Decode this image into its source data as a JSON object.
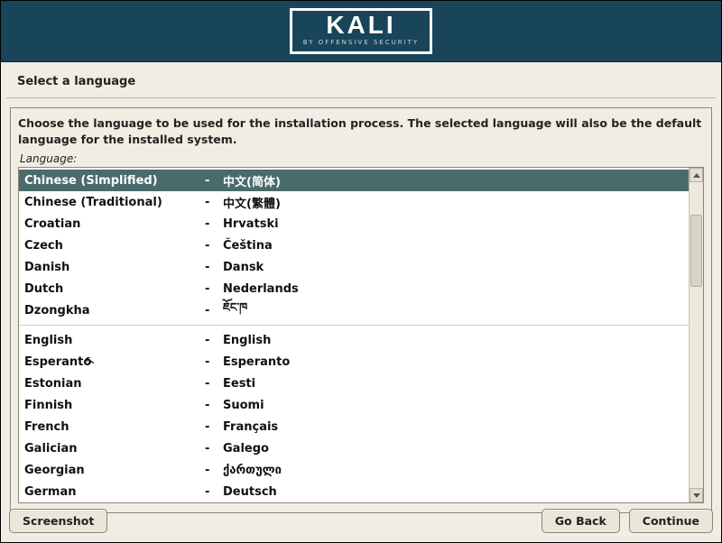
{
  "logo": {
    "text": "KALI",
    "subtitle": "BY OFFENSIVE SECURITY"
  },
  "title": "Select a language",
  "instruction": "Choose the language to be used for the installation process. The selected language will also be the default language for the installed system.",
  "field_label": "Language:",
  "selected_index": 0,
  "languages": [
    {
      "name": "Chinese (Simplified)",
      "native": "中文(简体)",
      "group": 1
    },
    {
      "name": "Chinese (Traditional)",
      "native": "中文(繁體)",
      "group": 1
    },
    {
      "name": "Croatian",
      "native": "Hrvatski",
      "group": 1
    },
    {
      "name": "Czech",
      "native": "Čeština",
      "group": 1
    },
    {
      "name": "Danish",
      "native": "Dansk",
      "group": 1
    },
    {
      "name": "Dutch",
      "native": "Nederlands",
      "group": 1
    },
    {
      "name": "Dzongkha",
      "native": "ཇོང་ཁ",
      "group": 1
    },
    {
      "name": "English",
      "native": "English",
      "group": 2
    },
    {
      "name": "Esperanto",
      "native": "Esperanto",
      "group": 2
    },
    {
      "name": "Estonian",
      "native": "Eesti",
      "group": 2
    },
    {
      "name": "Finnish",
      "native": "Suomi",
      "group": 2
    },
    {
      "name": "French",
      "native": "Français",
      "group": 2
    },
    {
      "name": "Galician",
      "native": "Galego",
      "group": 2
    },
    {
      "name": "Georgian",
      "native": "ქართული",
      "group": 2
    },
    {
      "name": "German",
      "native": "Deutsch",
      "group": 2
    }
  ],
  "buttons": {
    "screenshot": "Screenshot",
    "go_back": "Go Back",
    "continue": "Continue"
  }
}
